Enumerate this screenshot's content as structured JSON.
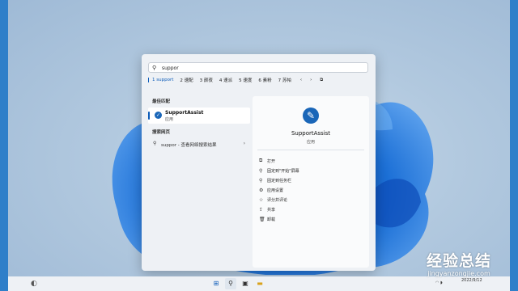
{
  "search": {
    "query": "suppor",
    "icon": "search-icon"
  },
  "ime": {
    "candidates": [
      "1 support",
      "2 速配",
      "3 颜夜",
      "4 速派",
      "5 速度",
      "6 素粉",
      "7 苏帕"
    ],
    "prev_icon": "chevron-left-icon",
    "next_icon": "chevron-right-icon",
    "expand_icon": "expand-icon"
  },
  "left": {
    "best_match_title": "最佳匹配",
    "best_match": {
      "name": "SupportAssist",
      "type": "应用",
      "icon": "wrench-icon"
    },
    "web_title": "搜索网页",
    "web_result": {
      "text": "suppor - 查看网络搜索结果",
      "chevron": "›"
    }
  },
  "detail": {
    "app_name": "SupportAssist",
    "app_type": "应用",
    "actions": [
      {
        "icon": "open-icon",
        "label": "打开"
      },
      {
        "icon": "pin-start-icon",
        "label": "固定到\"开始\"屏幕"
      },
      {
        "icon": "pin-taskbar-icon",
        "label": "固定到任务栏"
      },
      {
        "icon": "settings-icon",
        "label": "应用设置"
      },
      {
        "icon": "rate-icon",
        "label": "评分并评论"
      },
      {
        "icon": "share-icon",
        "label": "共享"
      },
      {
        "icon": "trash-icon",
        "label": "卸载"
      }
    ]
  },
  "taskbar": {
    "apps": [
      "start-icon",
      "search-icon",
      "task-view-icon",
      "explorer-icon"
    ],
    "time": "2022/9/12"
  },
  "watermark": {
    "main": "经验总结",
    "sub": "jingyanzongjie.com"
  },
  "colors": {
    "accent": "#0a5ab8",
    "wallpaper": "#b2c9df",
    "bloom": "#1b6fd6"
  }
}
